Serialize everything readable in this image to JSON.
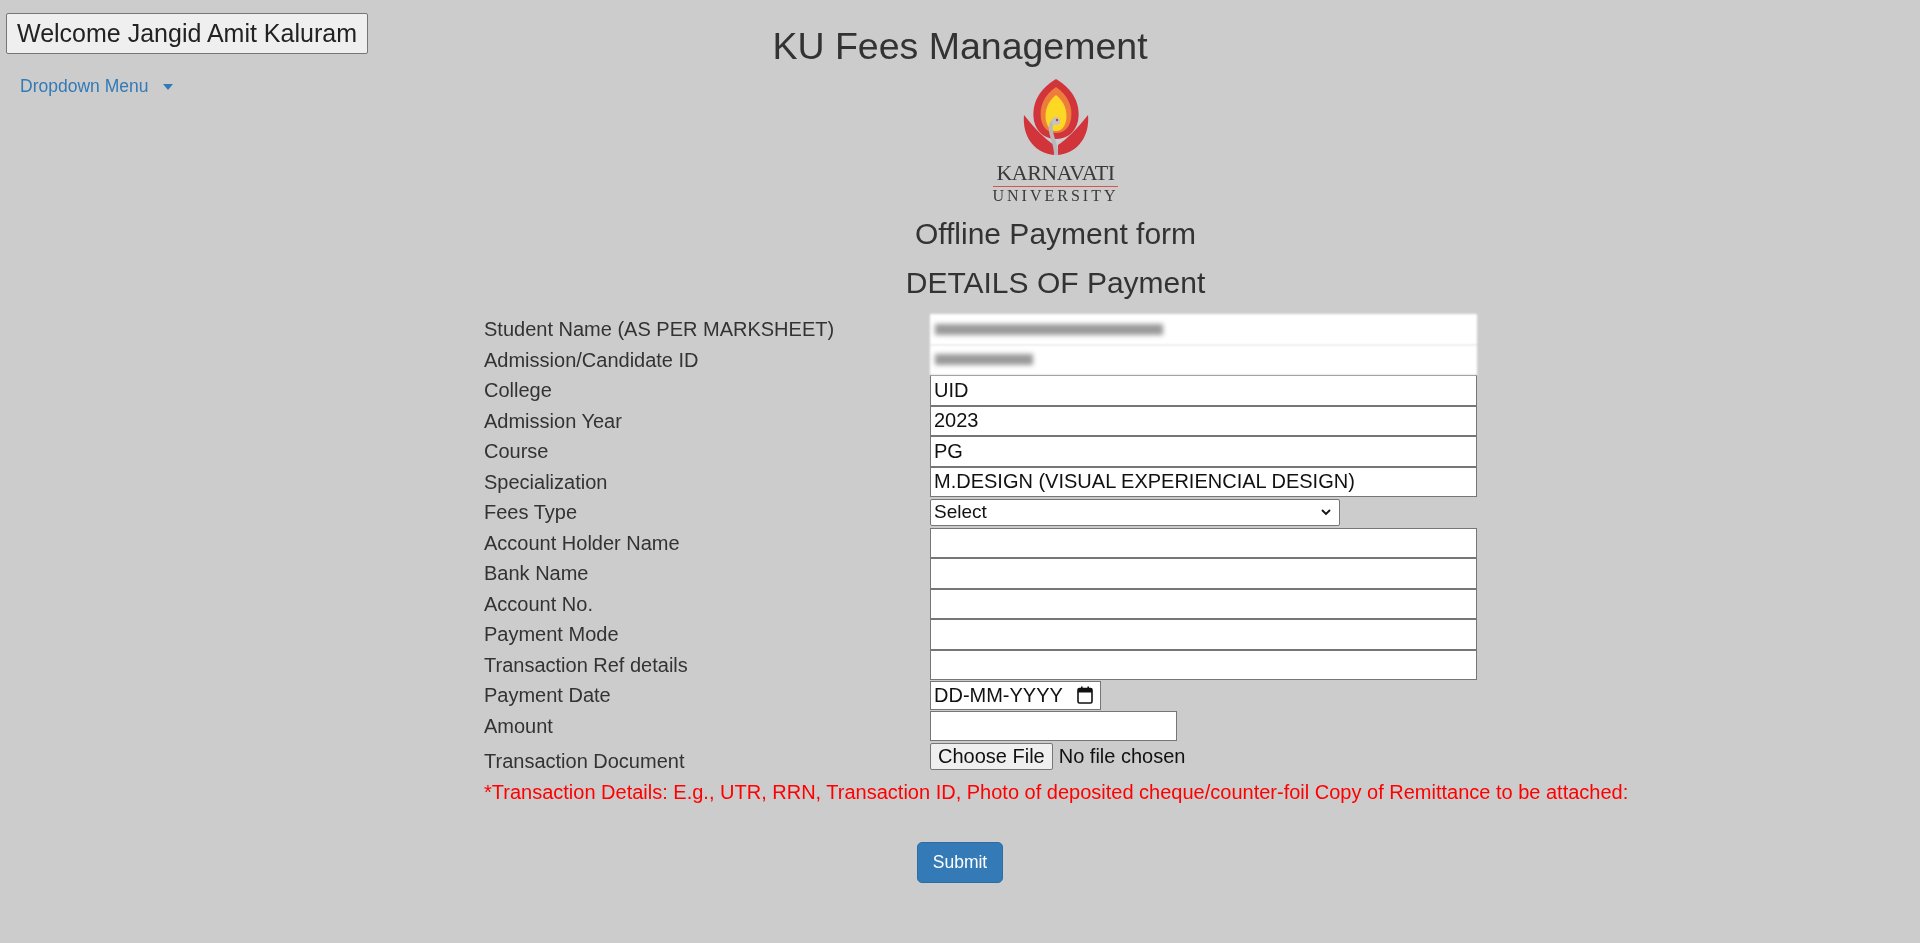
{
  "header": {
    "welcome": "Welcome Jangid Amit Kaluram",
    "title": "KU Fees Management"
  },
  "menu": {
    "label": "Dropdown Menu"
  },
  "logo": {
    "name": "KARNAVATI",
    "subtitle": "UNIVERSITY"
  },
  "form": {
    "title": "Offline Payment form",
    "section": "DETAILS OF Payment",
    "fields": [
      {
        "label": "Student Name (AS PER MARKSHEET)",
        "kind": "redacted"
      },
      {
        "label": "Admission/Candidate ID",
        "kind": "redacted"
      },
      {
        "label": "College",
        "kind": "text",
        "value": "UID"
      },
      {
        "label": "Admission Year",
        "kind": "text",
        "value": "2023"
      },
      {
        "label": "Course",
        "kind": "text",
        "value": "PG"
      },
      {
        "label": "Specialization",
        "kind": "text",
        "value": "M.DESIGN (VISUAL EXPERIENCIAL DESIGN)"
      },
      {
        "label": "Fees Type",
        "kind": "select",
        "value": "Select"
      },
      {
        "label": "Account Holder Name",
        "kind": "text"
      },
      {
        "label": "Bank Name",
        "kind": "text"
      },
      {
        "label": "Account No.",
        "kind": "text"
      },
      {
        "label": "Payment Mode",
        "kind": "text"
      },
      {
        "label": "Transaction Ref details",
        "kind": "text"
      },
      {
        "label": "Payment Date",
        "kind": "date",
        "placeholder": "DD-MM-YYYY"
      },
      {
        "label": "Amount",
        "kind": "short"
      },
      {
        "label": "Transaction Document",
        "kind": "file",
        "button": "Choose File",
        "status": "No file chosen"
      }
    ],
    "note": "*Transaction Details: E.g., UTR, RRN, Transaction ID, Photo of deposited cheque/counter-foil Copy of Remittance to be attached:",
    "submit": "Submit"
  }
}
